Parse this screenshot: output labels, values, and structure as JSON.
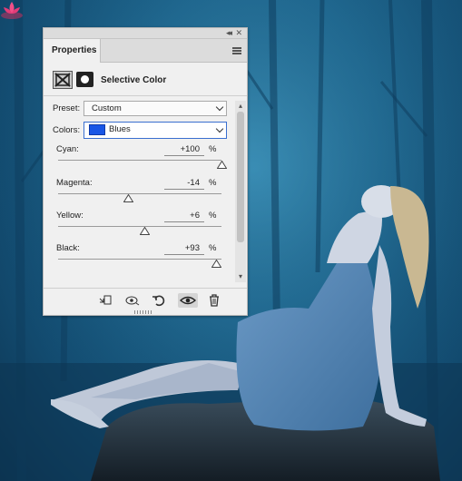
{
  "panel": {
    "tab_label": "Properties",
    "title": "Selective Color",
    "preset": {
      "label": "Preset:",
      "value": "Custom"
    },
    "colors": {
      "label": "Colors:",
      "value": "Blues",
      "swatch": "#1956e6"
    },
    "sliders": [
      {
        "name": "cyan",
        "label": "Cyan:",
        "value": "+100",
        "unit": "%",
        "level": 1.0
      },
      {
        "name": "magenta",
        "label": "Magenta:",
        "value": "-14",
        "unit": "%",
        "level": 0.43
      },
      {
        "name": "yellow",
        "label": "Yellow:",
        "value": "+6",
        "unit": "%",
        "level": 0.53
      },
      {
        "name": "black",
        "label": "Black:",
        "value": "+93",
        "unit": "%",
        "level": 0.965
      }
    ],
    "icons": [
      "selective-color-adjustment-icon",
      "layer-mask-icon",
      "clip-to-layer-icon",
      "view-previous-state-icon",
      "reset-icon",
      "visibility-eye-icon",
      "delete-icon"
    ]
  }
}
